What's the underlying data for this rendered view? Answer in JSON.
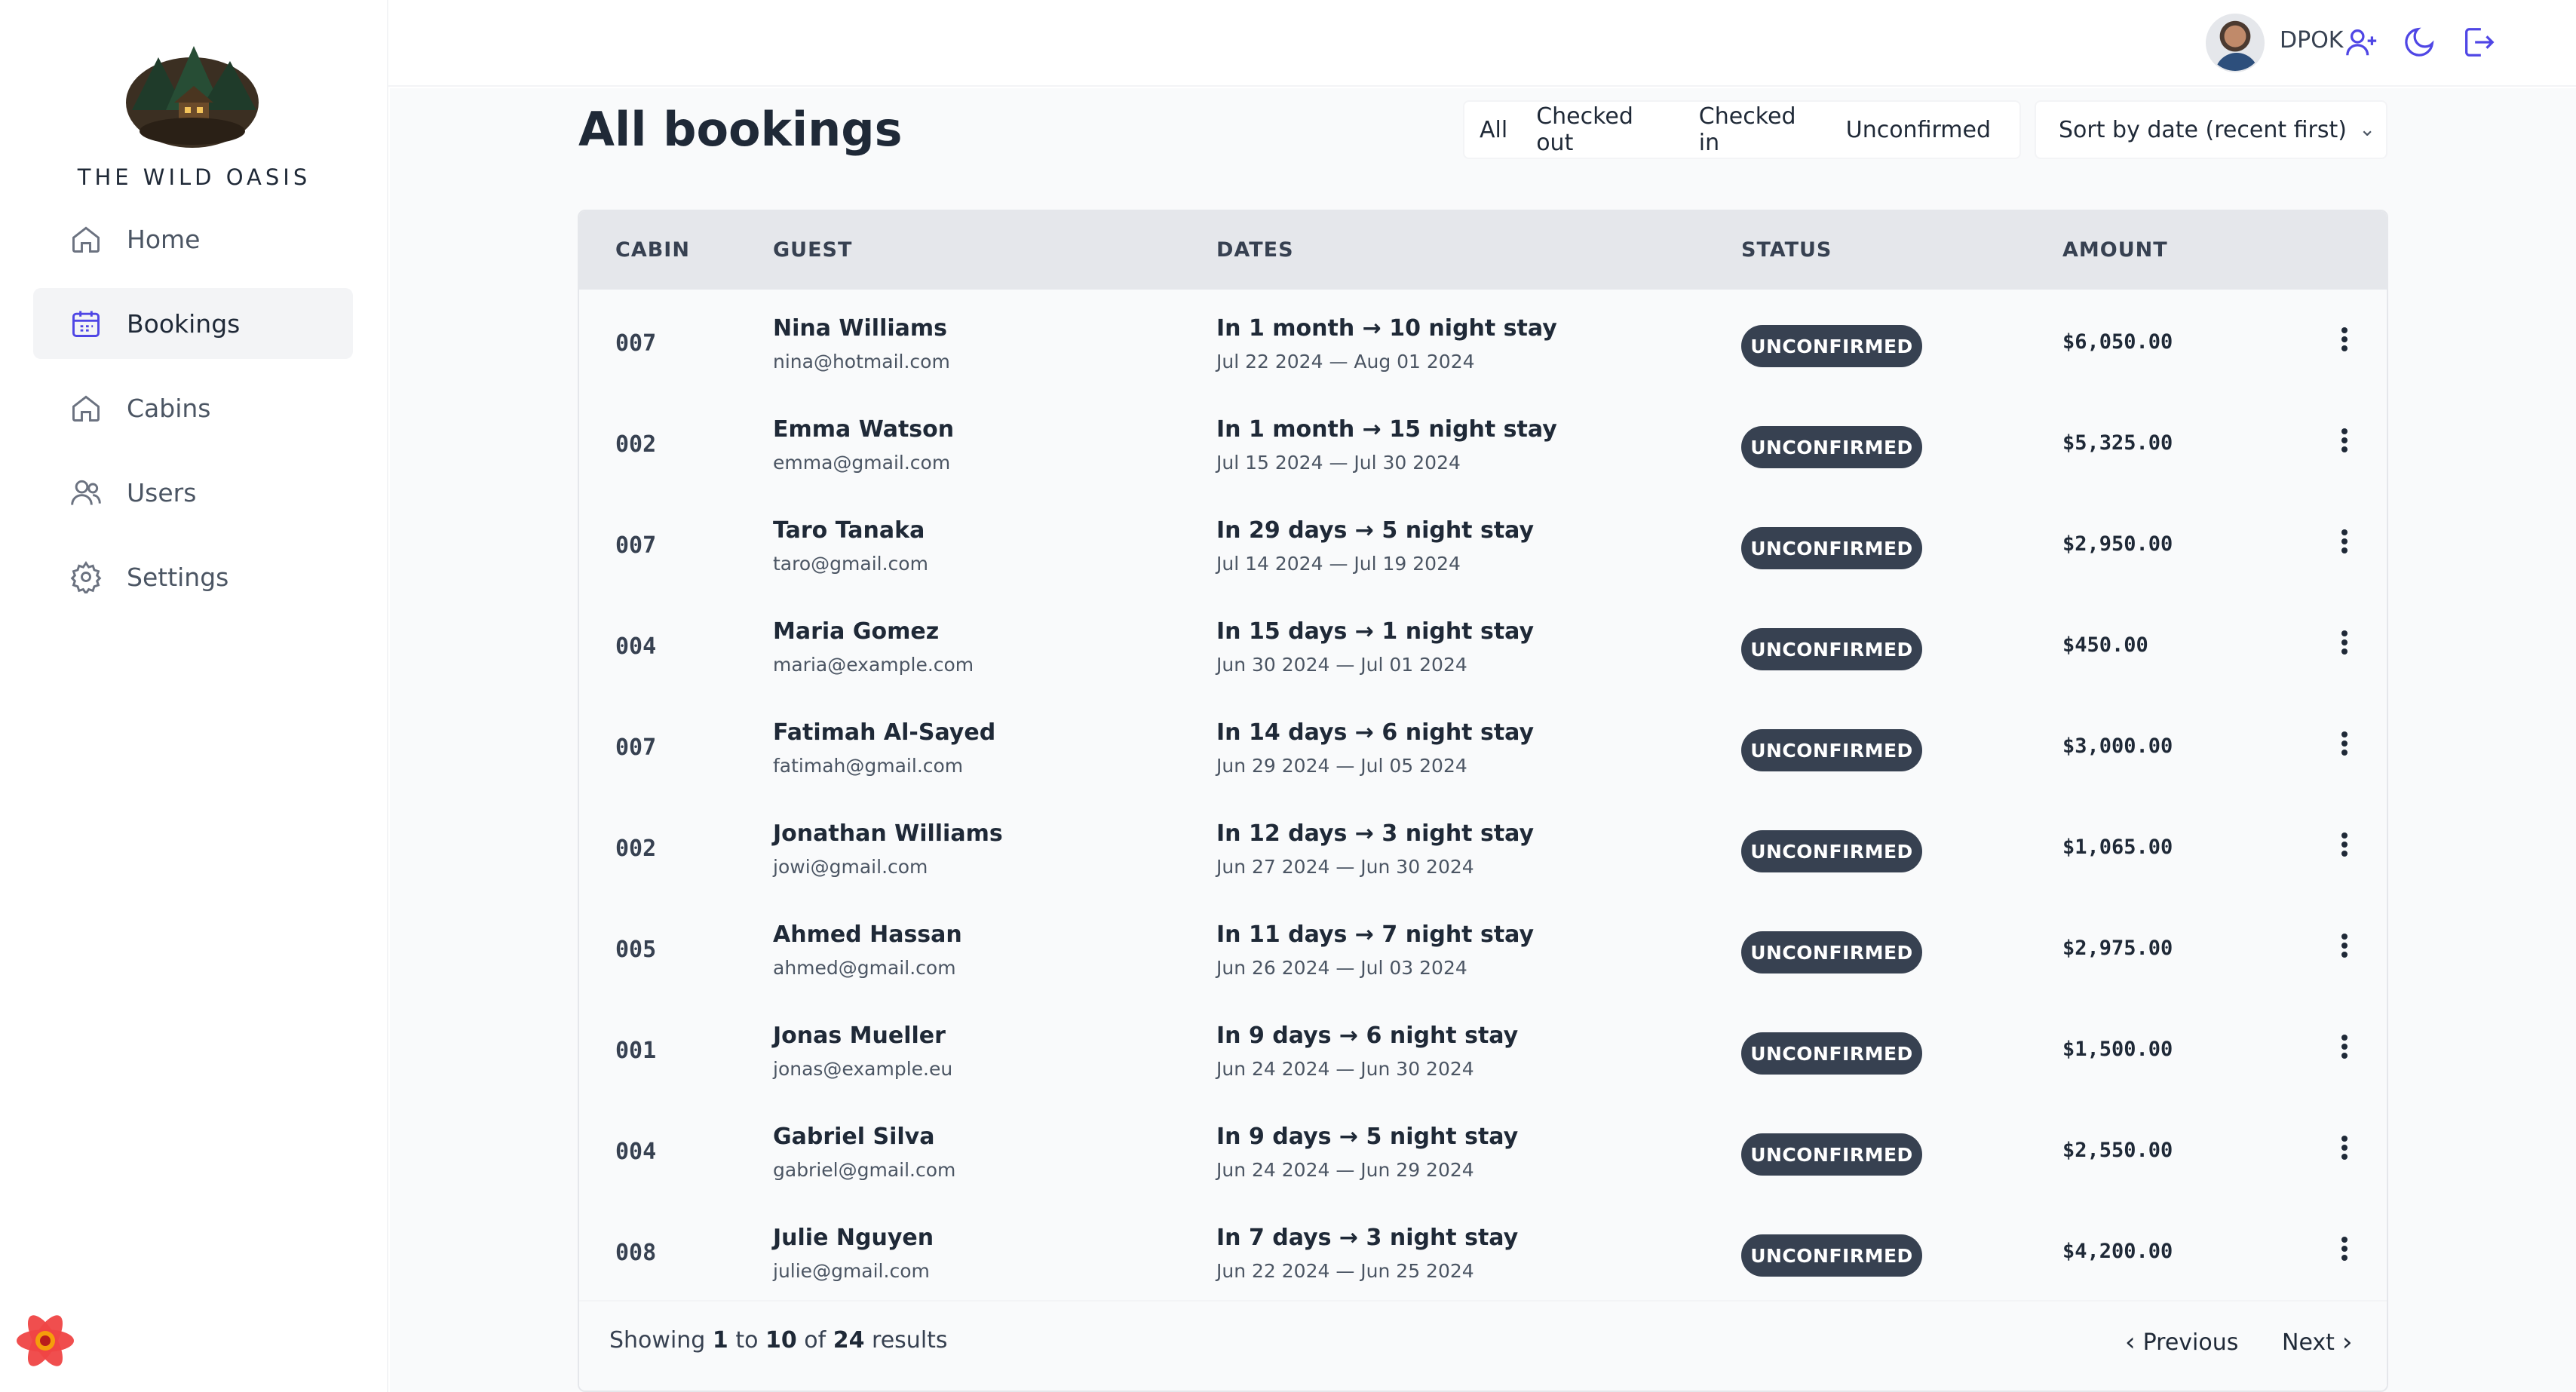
{
  "brand": {
    "name": "THE WILD OASIS"
  },
  "sidebar": {
    "items": [
      {
        "label": "Home",
        "icon": "home-icon"
      },
      {
        "label": "Bookings",
        "icon": "calendar-icon",
        "active": true
      },
      {
        "label": "Cabins",
        "icon": "home-icon"
      },
      {
        "label": "Users",
        "icon": "users-icon"
      },
      {
        "label": "Settings",
        "icon": "gear-icon"
      }
    ]
  },
  "header": {
    "user_name": "DPOK",
    "icons": [
      "add-user-icon",
      "moon-icon",
      "logout-icon"
    ],
    "accent": "#4f46e5"
  },
  "main": {
    "title": "All bookings",
    "filters": [
      "All",
      "Checked out",
      "Checked in",
      "Unconfirmed"
    ],
    "sort_label": "Sort by date (recent first)"
  },
  "table": {
    "columns": [
      "Cabin",
      "Guest",
      "Dates",
      "Status",
      "Amount"
    ],
    "rows": [
      {
        "cabin": "007",
        "guest": "Nina Williams",
        "email": "nina@hotmail.com",
        "stay": "In 1 month → 10 night stay",
        "range": "Jul 22 2024 — Aug 01 2024",
        "status": "UNCONFIRMED",
        "amount": "$6,050.00"
      },
      {
        "cabin": "002",
        "guest": "Emma Watson",
        "email": "emma@gmail.com",
        "stay": "In 1 month → 15 night stay",
        "range": "Jul 15 2024 — Jul 30 2024",
        "status": "UNCONFIRMED",
        "amount": "$5,325.00"
      },
      {
        "cabin": "007",
        "guest": "Taro Tanaka",
        "email": "taro@gmail.com",
        "stay": "In 29 days → 5 night stay",
        "range": "Jul 14 2024 — Jul 19 2024",
        "status": "UNCONFIRMED",
        "amount": "$2,950.00"
      },
      {
        "cabin": "004",
        "guest": "Maria Gomez",
        "email": "maria@example.com",
        "stay": "In 15 days → 1 night stay",
        "range": "Jun 30 2024 — Jul 01 2024",
        "status": "UNCONFIRMED",
        "amount": "$450.00"
      },
      {
        "cabin": "007",
        "guest": "Fatimah Al-Sayed",
        "email": "fatimah@gmail.com",
        "stay": "In 14 days → 6 night stay",
        "range": "Jun 29 2024 — Jul 05 2024",
        "status": "UNCONFIRMED",
        "amount": "$3,000.00"
      },
      {
        "cabin": "002",
        "guest": "Jonathan Williams",
        "email": "jowi@gmail.com",
        "stay": "In 12 days → 3 night stay",
        "range": "Jun 27 2024 — Jun 30 2024",
        "status": "UNCONFIRMED",
        "amount": "$1,065.00"
      },
      {
        "cabin": "005",
        "guest": "Ahmed Hassan",
        "email": "ahmed@gmail.com",
        "stay": "In 11 days → 7 night stay",
        "range": "Jun 26 2024 — Jul 03 2024",
        "status": "UNCONFIRMED",
        "amount": "$2,975.00"
      },
      {
        "cabin": "001",
        "guest": "Jonas Mueller",
        "email": "jonas@example.eu",
        "stay": "In 9 days → 6 night stay",
        "range": "Jun 24 2024 — Jun 30 2024",
        "status": "UNCONFIRMED",
        "amount": "$1,500.00"
      },
      {
        "cabin": "004",
        "guest": "Gabriel Silva",
        "email": "gabriel@gmail.com",
        "stay": "In 9 days → 5 night stay",
        "range": "Jun 24 2024 — Jun 29 2024",
        "status": "UNCONFIRMED",
        "amount": "$2,550.00"
      },
      {
        "cabin": "008",
        "guest": "Julie Nguyen",
        "email": "julie@gmail.com",
        "stay": "In 7 days → 3 night stay",
        "range": "Jun 22 2024 — Jun 25 2024",
        "status": "UNCONFIRMED",
        "amount": "$4,200.00"
      }
    ]
  },
  "pagination": {
    "showing_prefix": "Showing",
    "from": "1",
    "to_word": "to",
    "to": "10",
    "of_word": "of",
    "total": "24",
    "suffix": "results",
    "previous": "Previous",
    "next": "Next"
  }
}
